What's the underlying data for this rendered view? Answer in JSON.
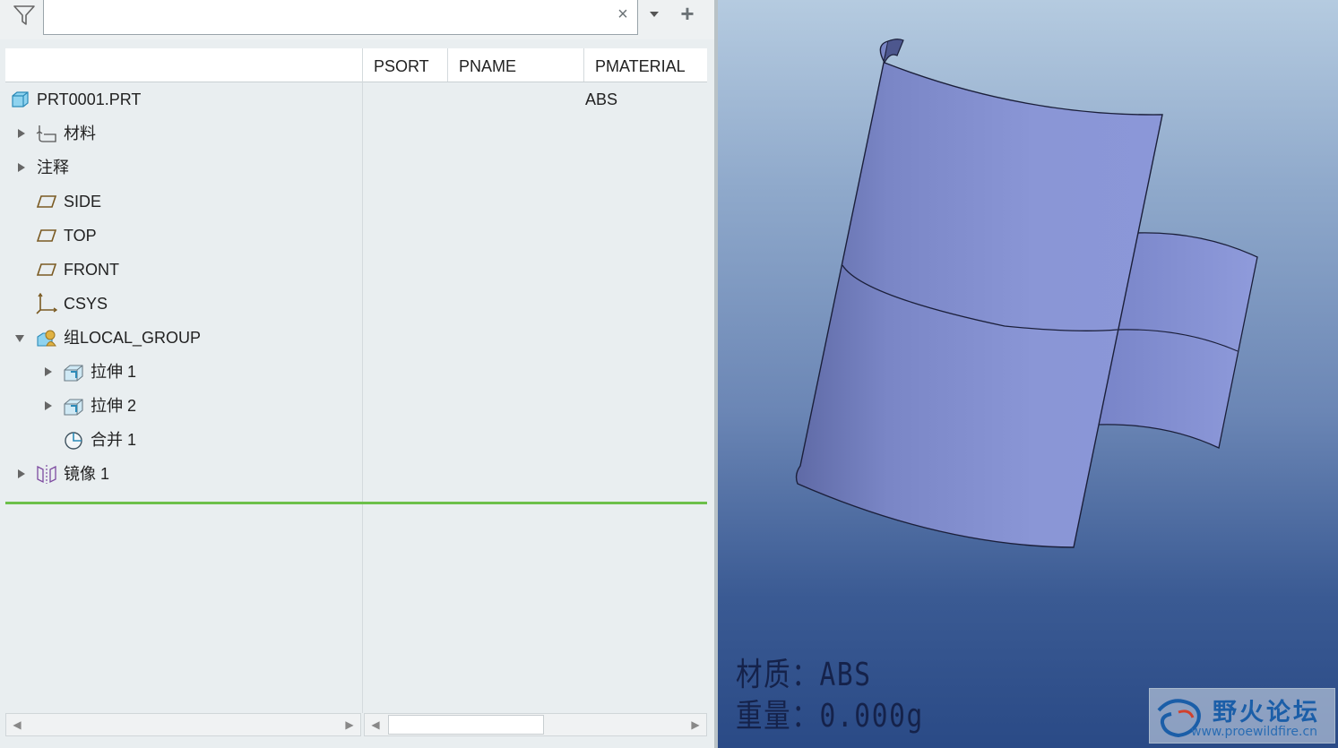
{
  "search": {
    "value": "",
    "placeholder": ""
  },
  "icons": {
    "filter": "filter-icon",
    "clear": "close-icon",
    "dropdown": "chevron-down-icon",
    "add": "plus-icon",
    "part": "part-icon",
    "material": "material-icon",
    "plane": "datum-plane-icon",
    "csys": "csys-icon",
    "group": "group-icon",
    "extrude": "extrude-icon",
    "merge": "merge-icon",
    "mirror": "mirror-icon"
  },
  "columns": [
    "PSORT",
    "PNAME",
    "PMATERIAL"
  ],
  "tree": [
    {
      "label": "PRT0001.PRT",
      "pmaterial": "ABS"
    },
    {
      "label": "材料"
    },
    {
      "label": "注释"
    },
    {
      "label": "SIDE"
    },
    {
      "label": "TOP"
    },
    {
      "label": "FRONT"
    },
    {
      "label": "CSYS"
    },
    {
      "label": "组LOCAL_GROUP"
    },
    {
      "label": "拉伸 1"
    },
    {
      "label": "拉伸 2"
    },
    {
      "label": "合并 1"
    },
    {
      "label": "镜像 1"
    }
  ],
  "viewport": {
    "material_text": "材质：ABS",
    "weight_text": "重量：0.000g"
  },
  "watermark": {
    "name": "野火论坛",
    "url": "www.proewildfire.cn"
  },
  "colors": {
    "accent_line": "#6cc04a",
    "surface": "#8a96d6"
  }
}
